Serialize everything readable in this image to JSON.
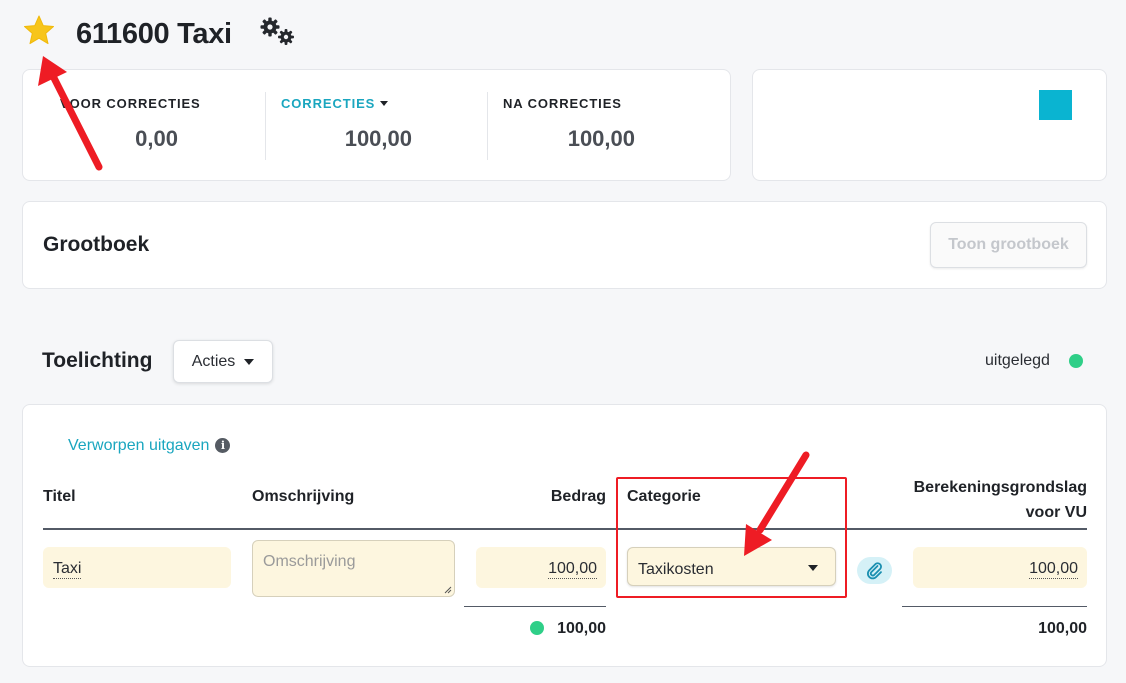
{
  "header": {
    "star_icon": "star-icon",
    "title": "611600 Taxi",
    "settings_icon": "gears-icon"
  },
  "corrections": {
    "voor_label": "VOOR CORRECTIES",
    "voor_value": "0,00",
    "correcties_label": "CORRECTIES",
    "correcties_value": "100,00",
    "na_label": "NA CORRECTIES",
    "na_value": "100,00"
  },
  "side_panel": {
    "accent_color": "#0ab4d1"
  },
  "grootboek": {
    "title": "Grootboek",
    "button_label": "Toon grootboek"
  },
  "toelichting": {
    "title": "Toelichting",
    "acties_label": "Acties",
    "status_label": "uitgelegd",
    "status_color": "#2fcf88"
  },
  "table": {
    "section_link": "Verworpen uitgaven",
    "columns": {
      "titel": "Titel",
      "omschrijving": "Omschrijving",
      "bedrag": "Bedrag",
      "categorie": "Categorie",
      "grondslag_line1": "Berekeningsgrondslag",
      "grondslag_line2": "voor VU"
    },
    "row": {
      "titel": "Taxi",
      "omschrijving_placeholder": "Omschrijving",
      "bedrag": "100,00",
      "categorie": "Taxikosten",
      "attachment_icon": "paperclip-icon",
      "grondslag": "100,00"
    },
    "totals": {
      "bedrag": "100,00",
      "grondslag": "100,00"
    }
  },
  "annotations": {
    "highlight_color": "#ee1c24"
  }
}
